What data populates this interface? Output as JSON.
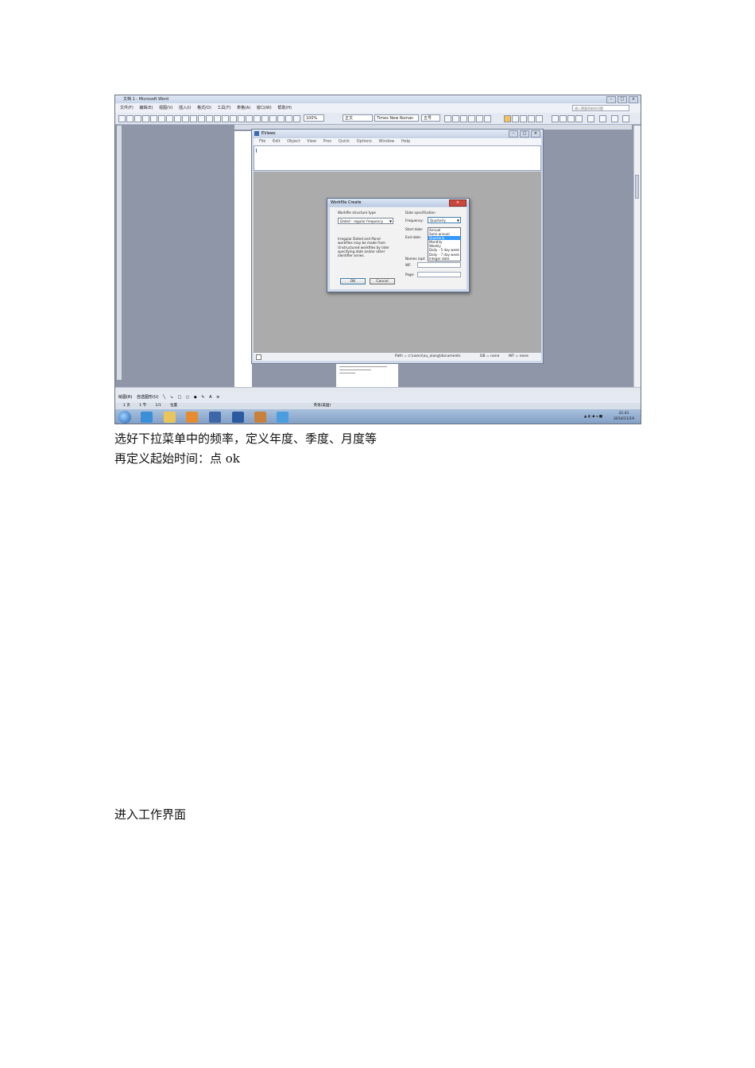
{
  "word": {
    "title": "文档 1 - Microsoft Word",
    "menu": [
      "文件(F)",
      "编辑(E)",
      "视图(V)",
      "插入(I)",
      "格式(O)",
      "工具(T)",
      "表格(A)",
      "窗口(W)",
      "帮助(H)"
    ],
    "help_placeholder": "键入需要帮助的问题",
    "zoom": "100%",
    "style": "正文",
    "font": "Times New Roman",
    "font_size": "五号",
    "draw_label": "绘图(R)",
    "autoshape_label": "自选图形(U)",
    "status": [
      "1 页",
      "1 节",
      "1/1",
      "位置"
    ],
    "status_lang": "英语(美国)"
  },
  "eviews": {
    "title": "EViews",
    "menu": [
      "File",
      "Edit",
      "Object",
      "View",
      "Proc",
      "Quick",
      "Options",
      "Window",
      "Help"
    ],
    "status_path": "Path = c:\\users\\xu_xiang\\documents",
    "status_db": "DB = none",
    "status_wf": "WF = none"
  },
  "dialog": {
    "title": "Workfile Create",
    "structure_label": "Workfile structure type",
    "structure_value": "Dated - regular frequency",
    "description": [
      "Irregular Dated and Panel",
      "workfiles may be made from",
      "Unstructured workfiles by later",
      "specifying date and/or other",
      "identifier series."
    ],
    "date_spec_label": "Date specification",
    "frequency_label": "Frequency:",
    "frequency_value": "Quarterly",
    "start_label": "Start date:",
    "end_label": "End date:",
    "names_label": "Names (opt",
    "wf_label": "WF:",
    "page_label": "Page:",
    "options": [
      "Annual",
      "Semi-annual",
      "Quarterly",
      "Monthly",
      "Weekly",
      "Daily - 5 day week",
      "Daily - 7 day week",
      "Integer date"
    ],
    "ok": "OK",
    "cancel": "Cancel"
  },
  "taskbar": {
    "time": "21:41",
    "date": "2014/11/19"
  },
  "captions": {
    "line1": "选好下拉菜单中的频率，定义年度、季度、月度等",
    "line2": "再定义起始时间：点 ok",
    "line3": "进入工作界面"
  }
}
